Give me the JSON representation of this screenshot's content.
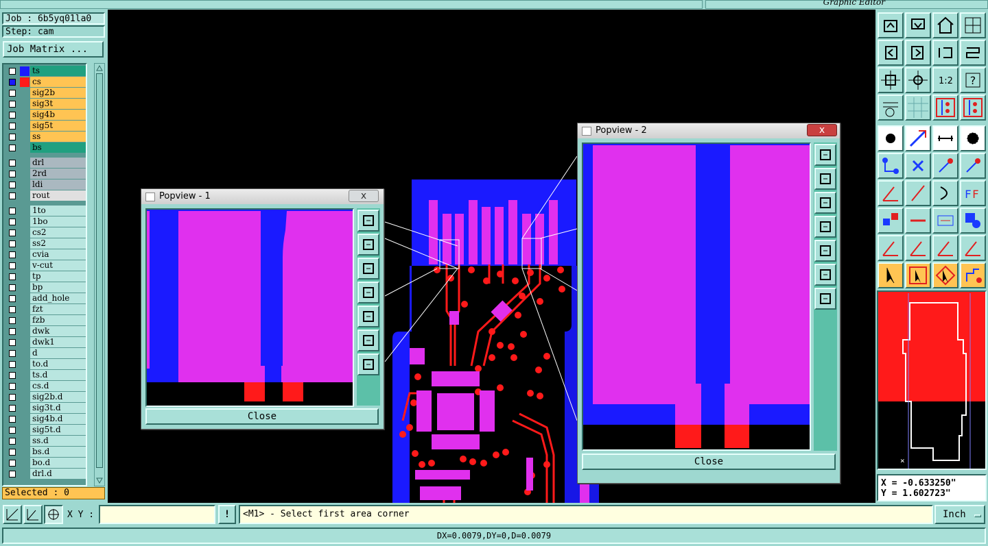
{
  "window": {
    "title": "Graphic Editor"
  },
  "job": {
    "job_label": "Job : 6b5yq01la0",
    "step_label": "Step: cam",
    "matrix_button": "Job Matrix ..."
  },
  "colors": {
    "top_layer": "#1a1aff",
    "bottom_layer": "#ff1a1a",
    "combined": "#e030ee",
    "bg": "#000000",
    "panel": "#9ed8d0",
    "board_layer": "#20a080",
    "signal_layer": "#ffc453",
    "drill_layer": "#aab8c0",
    "other_layer": "#b9e6e0"
  },
  "layers": [
    {
      "name": "ts",
      "kind": "board",
      "color": "#1a1aff"
    },
    {
      "name": "cs",
      "kind": "signal",
      "color": "#ff1a1a"
    },
    {
      "name": "sig2b",
      "kind": "signal"
    },
    {
      "name": "sig3t",
      "kind": "signal"
    },
    {
      "name": "sig4b",
      "kind": "signal"
    },
    {
      "name": "sig5t",
      "kind": "signal"
    },
    {
      "name": "ss",
      "kind": "signal"
    },
    {
      "name": "bs",
      "kind": "board"
    },
    {
      "name": "drl",
      "kind": "drill"
    },
    {
      "name": "2rd",
      "kind": "drill"
    },
    {
      "name": "ldi",
      "kind": "drill"
    },
    {
      "name": "rout",
      "kind": "rout"
    },
    {
      "name": "1to"
    },
    {
      "name": "1bo"
    },
    {
      "name": "cs2"
    },
    {
      "name": "ss2"
    },
    {
      "name": "cvia"
    },
    {
      "name": "v-cut"
    },
    {
      "name": "tp"
    },
    {
      "name": "bp"
    },
    {
      "name": "add_hole"
    },
    {
      "name": "fzt"
    },
    {
      "name": "fzb"
    },
    {
      "name": "dwk"
    },
    {
      "name": "dwk1"
    },
    {
      "name": "d"
    },
    {
      "name": "to.d"
    },
    {
      "name": "ts.d"
    },
    {
      "name": "cs.d"
    },
    {
      "name": "sig2b.d"
    },
    {
      "name": "sig3t.d"
    },
    {
      "name": "sig4b.d"
    },
    {
      "name": "sig5t.d"
    },
    {
      "name": "ss.d"
    },
    {
      "name": "bs.d"
    },
    {
      "name": "bo.d"
    },
    {
      "name": "drl.d"
    }
  ],
  "selected_label": "Selected : 0",
  "popup1": {
    "title": "Popview - 1",
    "close_label": "Close",
    "close_x": "x"
  },
  "popup2": {
    "title": "Popview - 2",
    "close_label": "Close",
    "close_x": "x"
  },
  "cmd": {
    "xy_label": "X Y :",
    "xy_value": "",
    "prompt": "<M1> - Select first area corner",
    "units": "Inch",
    "warn": "!"
  },
  "status": {
    "delta": "DX=0.0079,DY=0,D=0.0079"
  },
  "coords": {
    "x": "X = -0.633250\"",
    "y": "Y = 1.602723\""
  },
  "toolbar_icons": [
    "step-up-icon",
    "step-down-icon",
    "home-icon",
    "grid-select-icon",
    "step-left-icon",
    "step-right-icon",
    "undo-zoom-icon",
    "redraw-icon",
    "zoom-fit-icon",
    "zoom-center-icon",
    "zoom-1to1-icon",
    "help-icon",
    "tools-palette-icon",
    "grid-icon",
    "layer-compare-icon",
    "layer-connect-icon",
    "pad-icon",
    "line-draw-icon",
    "measure-icon",
    "circle-icon",
    "snap-node-icon",
    "snap-center-icon",
    "snap-end-icon",
    "snap-point-icon",
    "angle-icon",
    "slash-icon",
    "arc-icon",
    "text-edit-icon",
    "select-icon",
    "line-icon",
    "dimension-icon",
    "feature-icon",
    "triangle-icon",
    "triangle-plus-icon",
    "triangle-top-icon",
    "triangle-edge-icon",
    "pointer-icon",
    "pointer-box-icon",
    "pointer-circle-icon",
    "route-icon"
  ]
}
